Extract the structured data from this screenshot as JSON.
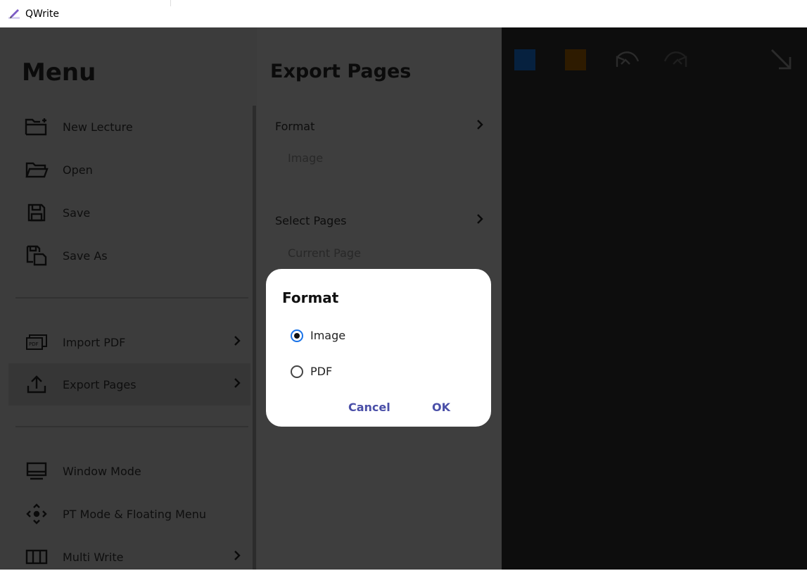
{
  "window": {
    "title": "QWrite"
  },
  "menu": {
    "title": "Menu",
    "items": [
      {
        "label": "New Lecture",
        "icon": "new-folder-icon"
      },
      {
        "label": "Open",
        "icon": "folder-open-icon"
      },
      {
        "label": "Save",
        "icon": "save-icon"
      },
      {
        "label": "Save As",
        "icon": "save-as-icon"
      },
      {
        "label": "Import PDF",
        "icon": "pdf-icon"
      },
      {
        "label": "Export Pages",
        "icon": "upload-icon"
      },
      {
        "label": "Window Mode",
        "icon": "monitor-icon"
      },
      {
        "label": "PT Mode & Floating Menu",
        "icon": "move-icon"
      },
      {
        "label": "Multi Write",
        "icon": "columns-icon"
      }
    ]
  },
  "export": {
    "title": "Export Pages",
    "format_label": "Format",
    "format_value": "Image",
    "pages_label": "Select Pages",
    "pages_value": "Current Page"
  },
  "dialog": {
    "title": "Format",
    "options": [
      "Image",
      "PDF"
    ],
    "selected": "Image",
    "cancel": "Cancel",
    "ok": "OK"
  },
  "colors": {
    "swatch_blue": "#06213f",
    "swatch_orange": "#2e1b00",
    "accent": "#4a4fa8",
    "radio_selected": "#1a73e8"
  }
}
